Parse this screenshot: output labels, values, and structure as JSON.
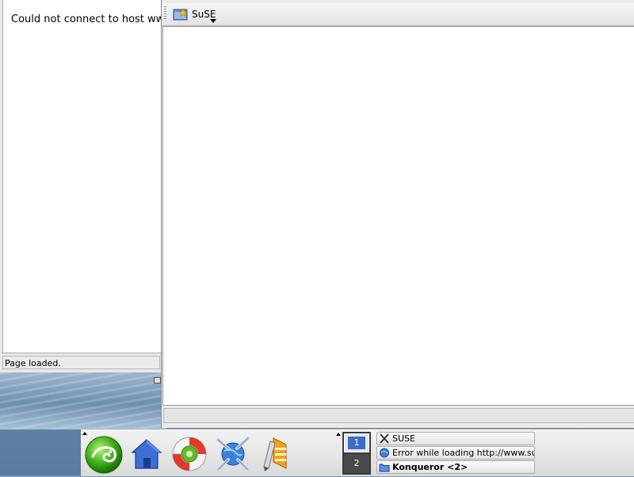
{
  "back_window": {
    "message": "Could not connect to host www.suse.de.",
    "status": "Page loaded."
  },
  "front_window": {
    "bookmark_button": "SuSE",
    "status": ""
  },
  "taskbar": {
    "launchers": [
      {
        "name": "suse-menu",
        "icon": "suse-gecko-icon"
      },
      {
        "name": "home",
        "icon": "home-icon"
      },
      {
        "name": "help",
        "icon": "lifebuoy-icon"
      },
      {
        "name": "web-browser",
        "icon": "konqueror-icon"
      },
      {
        "name": "office",
        "icon": "pencil-icon"
      }
    ],
    "pager": {
      "desktops": [
        "1",
        "2"
      ],
      "active": "1"
    },
    "tasks": [
      {
        "label": "SUSE",
        "icon": "x-icon"
      },
      {
        "label": "Error while loading http://www.suse.de",
        "icon": "konqueror-icon"
      },
      {
        "label": "Konqueror <2>",
        "icon": "folder-icon",
        "active": true
      }
    ]
  }
}
